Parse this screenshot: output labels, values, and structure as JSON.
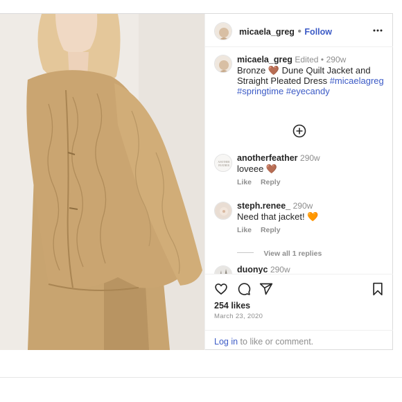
{
  "post": {
    "username": "micaela_greg",
    "follow_label": "Follow",
    "more_icon": "more-options-icon",
    "caption": {
      "username": "micaela_greg",
      "edited": "Edited",
      "separator": "•",
      "time": "290w",
      "text_before_emoji": "Bronze",
      "emoji": "🤎",
      "text_after_emoji": "Dune Quilt Jacket and Straight Pleated Dress",
      "hashtags_line1": "#micaelagreg",
      "hashtags_line2": "#springtime #eyecandy"
    },
    "load_more_icon": "plus-circle-icon",
    "comments": [
      {
        "username": "anotherfeather",
        "time": "290w",
        "text": "loveee 🤎",
        "like": "Like",
        "reply": "Reply"
      },
      {
        "username": "steph.renee_",
        "time": "290w",
        "text": "Need that jacket! 🧡",
        "like": "Like",
        "reply": "Reply",
        "view_replies": "View all 1 replies"
      },
      {
        "username": "duonyc",
        "time": "290w",
        "text": "🤍🤍🤍"
      }
    ],
    "likes": "254 likes",
    "date": "March 23, 2020",
    "login_link": "Log in",
    "login_rest": "to like or comment."
  },
  "colors": {
    "link_blue": "#3b5ac6",
    "muted": "#8e8e8e",
    "border": "#dbdbdb",
    "jacket": "#c9a46f"
  }
}
